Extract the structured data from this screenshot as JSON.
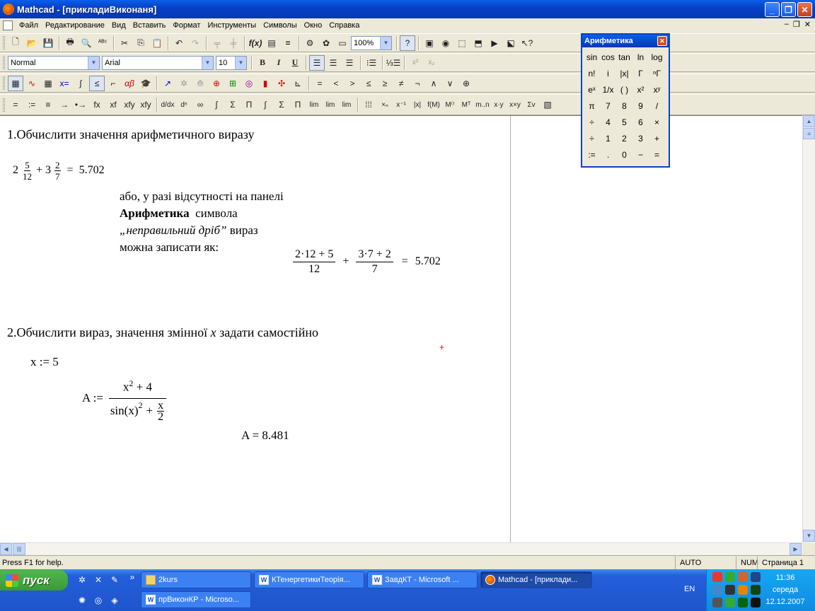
{
  "window": {
    "title": "Mathcad - [прикладиВиконаня]"
  },
  "menu": [
    "Файл",
    "Редактирование",
    "Вид",
    "Вставить",
    "Формат",
    "Инструменты",
    "Символы",
    "Окно",
    "Справка"
  ],
  "format_toolbar": {
    "style": "Normal",
    "font": "Arial",
    "size": "10"
  },
  "standard_toolbar": {
    "zoom": "100%"
  },
  "math_toolbar": {
    "compare_ops": [
      "=",
      "<",
      ">",
      "≤",
      "≥",
      "≠",
      "¬",
      "∧",
      "∨",
      "⊕"
    ],
    "eval_ops": [
      "=",
      ":=",
      "≡",
      "→",
      "•→",
      "fx",
      "xf",
      "xfy",
      "xfy"
    ]
  },
  "palette": {
    "title": "Арифметика",
    "buttons": [
      "sin",
      "cos",
      "tan",
      "ln",
      "log",
      "n!",
      "i",
      "|x|",
      "Γ",
      "ⁿΓ",
      "eˣ",
      "1/x",
      "( )",
      "x²",
      "xʸ",
      "π",
      "7",
      "8",
      "9",
      "/",
      "÷",
      "4",
      "5",
      "6",
      "×",
      "÷",
      "1",
      "2",
      "3",
      "+",
      ":=",
      ".",
      "0",
      "−",
      "="
    ]
  },
  "worksheet": {
    "heading1": "1.Обчислити значення арифметичного виразу",
    "expr1": {
      "whole1": "2",
      "num1": "5",
      "den1": "12",
      "op": "+",
      "whole2": "3",
      "num2": "2",
      "den2": "7",
      "eq": "=",
      "result": "5.702"
    },
    "note_lines": [
      "або, у разі відсутності на панелі",
      "Арифметика",
      "символа",
      "„неправильний дріб”",
      "вираз",
      "можна записати як:"
    ],
    "expr2": {
      "num1": "2·12 + 5",
      "den1": "12",
      "op": "+",
      "num2": "3·7 + 2",
      "den2": "7",
      "eq": "=",
      "result": "5.702"
    },
    "heading2_pre": "2.Обчислити вираз, значення змінної",
    "heading2_var": "x",
    "heading2_post": "задати самостійно",
    "assign_x": "x := 5",
    "def_A": {
      "lhs": "A :=",
      "num": "x",
      "num_exp": "2",
      "num_rest": "+ 4",
      "den_fn": "sin(x)",
      "den_exp": "2",
      "den_plus": "+",
      "den_fnum": "x",
      "den_fden": "2"
    },
    "result_A": "A = 8.481"
  },
  "statusbar": {
    "help": "Press F1 for help.",
    "mode": "AUTO",
    "num": "NUM",
    "page": "Страница 1"
  },
  "taskbar": {
    "start": "пуск",
    "buttons": [
      "2kurs",
      "КТенергетикиТеорія...",
      "ЗавдКТ - Microsoft ...",
      "Mathcad - [приклади...",
      "прВиконКР - Microso..."
    ],
    "lang": "EN",
    "time": "11:36",
    "day": "середа",
    "date": "12.12.2007"
  },
  "colors": {
    "titlebar": "#0842c8",
    "taskbar": "#245edb",
    "start": "#3a9a37",
    "cursor": "#e00000"
  }
}
